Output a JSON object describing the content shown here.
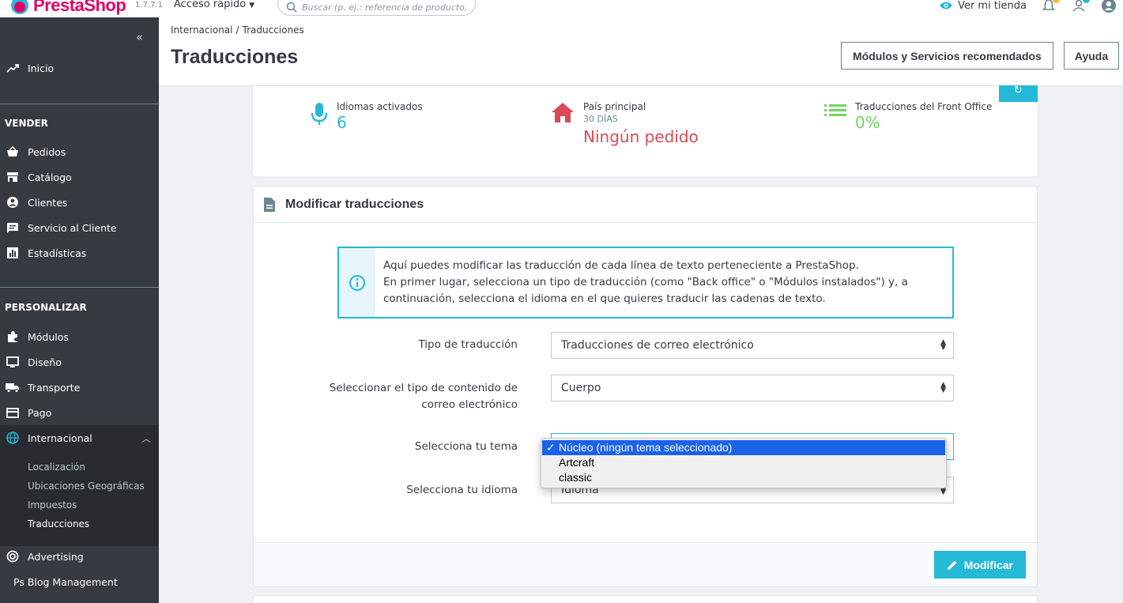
{
  "header": {
    "logo_text": "PrestaShop",
    "version": "1.7.7.1",
    "quick_access": "Acceso rápido",
    "search_placeholder": "Buscar (p. ej.: referencia de producto, nombre de cliente...)",
    "view_store": "Ver mi tienda"
  },
  "sidebar": {
    "inicio": "Inicio",
    "sections": {
      "vender": "VENDER",
      "personalizar": "PERSONALIZAR"
    },
    "vender_items": [
      "Pedidos",
      "Catálogo",
      "Clientes",
      "Servicio al Cliente",
      "Estadísticas"
    ],
    "personalizar_items": [
      "Módulos",
      "Diseño",
      "Transporte",
      "Pago",
      "Internacional"
    ],
    "internacional_sub": [
      "Localización",
      "Ubicaciones Geográficas",
      "Impuestos",
      "Traducciones"
    ],
    "extra_items": [
      "Advertising",
      "Ps Blog Management"
    ]
  },
  "page": {
    "breadcrumb": [
      "Internacional",
      "Traducciones"
    ],
    "title": "Traducciones",
    "btn_modules": "Módulos y Servicios recomendados",
    "btn_help": "Ayuda"
  },
  "kpis": [
    {
      "label": "Idiomas activados",
      "sub": "",
      "value": "6",
      "color": "#25b9d7"
    },
    {
      "label": "País principal",
      "sub": "30 DÍAS",
      "value": "Ningún pedido",
      "color": "#d94a56"
    },
    {
      "label": "Traducciones del Front Office",
      "sub": "",
      "value": "0%",
      "color": "#70d45f"
    }
  ],
  "translations": {
    "title": "Modificar traducciones",
    "info": [
      "Aquí puedes modificar las traducción de cada línea de texto perteneciente a PrestaShop.",
      "En primer lugar, selecciona un tipo de traducción (como \"Back office\" o \"Módulos instalados\") y, a",
      "continuación, selecciona el idioma en el que quieres traducir las cadenas de texto."
    ],
    "type_label": "Tipo de traducción",
    "type_value": "Traducciones de correo electrónico",
    "content_label_1": "Seleccionar el tipo de contenido de",
    "content_label_2": "correo electrónico",
    "content_value": "Cuerpo",
    "theme_label": "Selecciona tu tema",
    "theme_options": [
      "Núcleo (ningún tema seleccionado)",
      "Artcraft",
      "classic"
    ],
    "language_label": "Selecciona tu idioma",
    "language_value": "Idioma",
    "modify_button": "Modificar"
  },
  "colors": {
    "accent": "#25b9d7",
    "sidebar": "#363a41",
    "brand": "#df0067"
  }
}
